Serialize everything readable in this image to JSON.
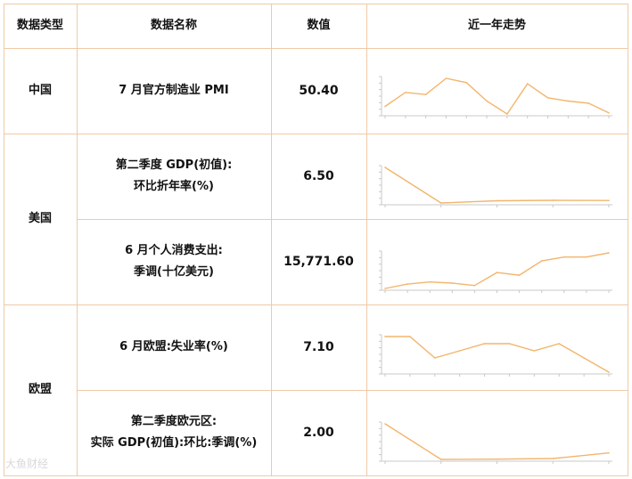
{
  "table": {
    "headers": [
      "数据类型",
      "数据名称",
      "数值",
      "近一年走势"
    ],
    "groups": [
      {
        "region": "中国"
      },
      {
        "region": "美国"
      },
      {
        "region": "欧盟"
      }
    ],
    "rows": [
      {
        "name_lines": [
          "7 月官方制造业 PMI"
        ],
        "value": "50.40"
      },
      {
        "name_lines": [
          "第二季度 GDP(初值):",
          "环比折年率(%)"
        ],
        "value": "6.50"
      },
      {
        "name_lines": [
          "6 月个人消费支出:",
          "季调(十亿美元)"
        ],
        "value": "15,771.60"
      },
      {
        "name_lines": [
          "6 月欧盟:失业率(%)"
        ],
        "value": "7.10"
      },
      {
        "name_lines": [
          "第二季度欧元区:",
          "实际 GDP(初值):环比:季调(%)"
        ],
        "value": "2.00"
      }
    ]
  },
  "watermark": "大鱼财经",
  "colors": {
    "line": "#f2b56b",
    "border": "#f0c9a6",
    "axis": "#c8c8c8"
  },
  "chart_data": [
    {
      "type": "line",
      "values": [
        49.8,
        51.1,
        50.9,
        52.4,
        52.0,
        50.3,
        49.1,
        51.9,
        50.6,
        50.3,
        50.1,
        49.2
      ]
    },
    {
      "type": "line",
      "values": [
        33.4,
        4.5,
        6.3,
        6.7,
        6.5
      ]
    },
    {
      "type": "line",
      "values": [
        14300,
        14480,
        14570,
        14520,
        14420,
        14960,
        14850,
        15440,
        15600,
        15600,
        15771.6
      ]
    },
    {
      "type": "line",
      "values": [
        7.6,
        7.6,
        7.3,
        7.4,
        7.5,
        7.5,
        7.4,
        7.5,
        7.3,
        7.1
      ]
    },
    {
      "type": "line",
      "values": [
        12.3,
        -0.3,
        -0.2,
        0.0,
        2.0
      ]
    }
  ]
}
